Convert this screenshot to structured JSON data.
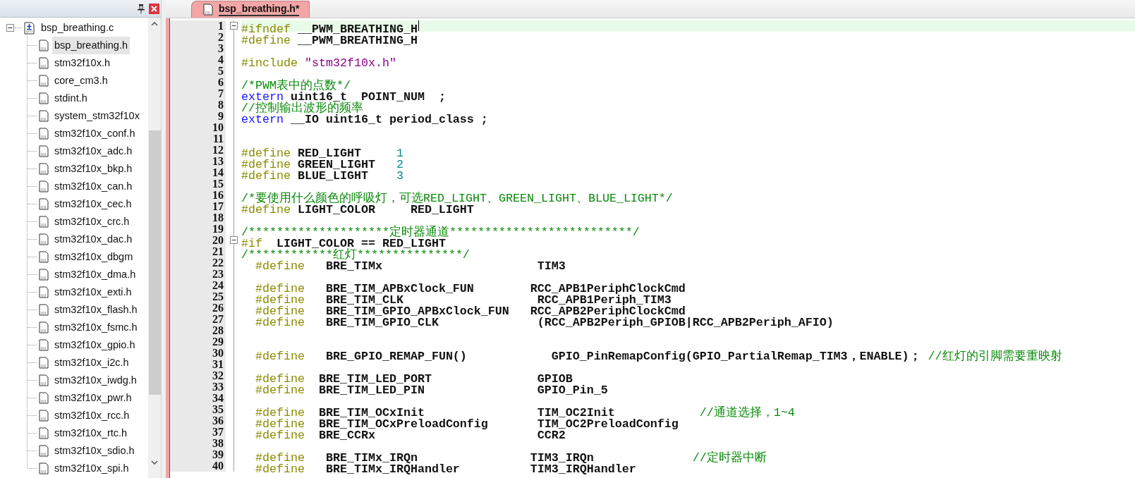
{
  "project_panel": {
    "tree": {
      "label": "bsp_breathing.c",
      "expanded": true,
      "children": [
        {
          "label": "bsp_breathing.h",
          "selected": true
        },
        {
          "label": "stm32f10x.h",
          "selected": false
        },
        {
          "label": "core_cm3.h",
          "selected": false
        },
        {
          "label": "stdint.h",
          "selected": false
        },
        {
          "label": "system_stm32f10x",
          "selected": false
        },
        {
          "label": "stm32f10x_conf.h",
          "selected": false
        },
        {
          "label": "stm32f10x_adc.h",
          "selected": false
        },
        {
          "label": "stm32f10x_bkp.h",
          "selected": false
        },
        {
          "label": "stm32f10x_can.h",
          "selected": false
        },
        {
          "label": "stm32f10x_cec.h",
          "selected": false
        },
        {
          "label": "stm32f10x_crc.h",
          "selected": false
        },
        {
          "label": "stm32f10x_dac.h",
          "selected": false
        },
        {
          "label": "stm32f10x_dbgm",
          "selected": false
        },
        {
          "label": "stm32f10x_dma.h",
          "selected": false
        },
        {
          "label": "stm32f10x_exti.h",
          "selected": false
        },
        {
          "label": "stm32f10x_flash.h",
          "selected": false
        },
        {
          "label": "stm32f10x_fsmc.h",
          "selected": false
        },
        {
          "label": "stm32f10x_gpio.h",
          "selected": false
        },
        {
          "label": "stm32f10x_i2c.h",
          "selected": false
        },
        {
          "label": "stm32f10x_iwdg.h",
          "selected": false
        },
        {
          "label": "stm32f10x_pwr.h",
          "selected": false
        },
        {
          "label": "stm32f10x_rcc.h",
          "selected": false
        },
        {
          "label": "stm32f10x_rtc.h",
          "selected": false
        },
        {
          "label": "stm32f10x_sdio.h",
          "selected": false
        },
        {
          "label": "stm32f10x_spi.h",
          "selected": false
        }
      ]
    }
  },
  "tabs": [
    {
      "label": "bsp_breathing.h*",
      "selected": true
    }
  ],
  "editor": {
    "lines": [
      {
        "number": "1",
        "fold": true,
        "current": true,
        "segments": [
          {
            "kind": "preproc",
            "text": "#ifndef"
          },
          {
            "kind": "plain",
            "text": " __PWM_BREATHING_H"
          }
        ]
      },
      {
        "number": "2",
        "fold": false,
        "current": false,
        "segments": [
          {
            "kind": "preproc",
            "text": "#define"
          },
          {
            "kind": "plain",
            "text": " __PWM_BREATHING_H"
          }
        ]
      },
      {
        "number": "3",
        "fold": false,
        "current": false
      },
      {
        "number": "4",
        "fold": false,
        "current": false,
        "segments": [
          {
            "kind": "preproc",
            "text": "#include"
          },
          {
            "kind": "string",
            "text": " \"stm32f10x.h\""
          }
        ]
      },
      {
        "number": "5",
        "fold": false,
        "current": false
      },
      {
        "number": "6",
        "fold": false,
        "current": false,
        "segments": [
          {
            "kind": "comment",
            "text": "/*PWM表中的点数*/"
          }
        ]
      },
      {
        "number": "7",
        "fold": false,
        "current": false,
        "segments": [
          {
            "kind": "keyword",
            "text": "extern"
          },
          {
            "kind": "plain",
            "text": " uint16_t  POINT_NUM  ;"
          }
        ]
      },
      {
        "number": "8",
        "fold": false,
        "current": false,
        "segments": [
          {
            "kind": "comment",
            "text": "//控制输出波形的频率"
          }
        ]
      },
      {
        "number": "9",
        "fold": false,
        "current": false,
        "segments": [
          {
            "kind": "keyword",
            "text": "extern"
          },
          {
            "kind": "plain",
            "text": " __IO uint16_t period_class ;"
          }
        ]
      },
      {
        "number": "10",
        "fold": false,
        "current": false
      },
      {
        "number": "11",
        "fold": false,
        "current": false
      },
      {
        "number": "12",
        "fold": false,
        "current": false,
        "segments": [
          {
            "kind": "preproc",
            "text": "#define"
          },
          {
            "kind": "plain",
            "text": " RED_LIGHT     "
          },
          {
            "kind": "number",
            "text": "1"
          }
        ]
      },
      {
        "number": "13",
        "fold": false,
        "current": false,
        "segments": [
          {
            "kind": "preproc",
            "text": "#define"
          },
          {
            "kind": "plain",
            "text": " GREEN_LIGHT   "
          },
          {
            "kind": "number",
            "text": "2"
          }
        ]
      },
      {
        "number": "14",
        "fold": false,
        "current": false,
        "segments": [
          {
            "kind": "preproc",
            "text": "#define"
          },
          {
            "kind": "plain",
            "text": " BLUE_LIGHT    "
          },
          {
            "kind": "number",
            "text": "3"
          }
        ]
      },
      {
        "number": "15",
        "fold": false,
        "current": false
      },
      {
        "number": "16",
        "fold": false,
        "current": false,
        "segments": [
          {
            "kind": "comment",
            "text": "/*要使用什么颜色的呼吸灯，可选RED_LIGHT、GREEN_LIGHT、BLUE_LIGHT*/"
          }
        ]
      },
      {
        "number": "17",
        "fold": false,
        "current": false,
        "segments": [
          {
            "kind": "preproc",
            "text": "#define"
          },
          {
            "kind": "plain",
            "text": " LIGHT_COLOR     RED_LIGHT"
          }
        ]
      },
      {
        "number": "18",
        "fold": false,
        "current": false
      },
      {
        "number": "19",
        "fold": false,
        "current": false,
        "segments": [
          {
            "kind": "comment",
            "text": "/********************定时器通道**************************/"
          }
        ]
      },
      {
        "number": "20",
        "fold": true,
        "current": false,
        "segments": [
          {
            "kind": "preproc",
            "text": "#if"
          },
          {
            "kind": "plain",
            "text": "  LIGHT_COLOR == RED_LIGHT"
          }
        ]
      },
      {
        "number": "21",
        "fold": false,
        "current": false,
        "segments": [
          {
            "kind": "comment",
            "text": "/************红灯***************/"
          }
        ]
      },
      {
        "number": "22",
        "fold": false,
        "current": false,
        "segments": [
          {
            "kind": "preproc",
            "text": "  #define"
          },
          {
            "kind": "plain",
            "text": "   BRE_TIMx                      TIM3"
          }
        ]
      },
      {
        "number": "23",
        "fold": false,
        "current": false
      },
      {
        "number": "24",
        "fold": false,
        "current": false,
        "segments": [
          {
            "kind": "preproc",
            "text": "  #define"
          },
          {
            "kind": "plain",
            "text": "   BRE_TIM_APBxClock_FUN        RCC_APB1PeriphClockCmd"
          }
        ]
      },
      {
        "number": "25",
        "fold": false,
        "current": false,
        "segments": [
          {
            "kind": "preproc",
            "text": "  #define"
          },
          {
            "kind": "plain",
            "text": "   BRE_TIM_CLK                   RCC_APB1Periph_TIM3"
          }
        ]
      },
      {
        "number": "26",
        "fold": false,
        "current": false,
        "segments": [
          {
            "kind": "preproc",
            "text": "  #define"
          },
          {
            "kind": "plain",
            "text": "   BRE_TIM_GPIO_APBxClock_FUN   RCC_APB2PeriphClockCmd"
          }
        ]
      },
      {
        "number": "27",
        "fold": false,
        "current": false,
        "segments": [
          {
            "kind": "preproc",
            "text": "  #define"
          },
          {
            "kind": "plain",
            "text": "   BRE_TIM_GPIO_CLK              (RCC_APB2Periph_GPIOB|RCC_APB2Periph_AFIO)"
          }
        ]
      },
      {
        "number": "28",
        "fold": false,
        "current": false
      },
      {
        "number": "29",
        "fold": false,
        "current": false
      },
      {
        "number": "30",
        "fold": false,
        "current": false,
        "segments": [
          {
            "kind": "preproc",
            "text": "  #define"
          },
          {
            "kind": "plain",
            "text": "   BRE_GPIO_REMAP_FUN()            GPIO_PinRemapConfig(GPIO_PartialRemap_TIM3，ENABLE)； "
          },
          {
            "kind": "comment",
            "text": "//红灯的引脚需要重映射"
          }
        ]
      },
      {
        "number": "31",
        "fold": false,
        "current": false
      },
      {
        "number": "32",
        "fold": false,
        "current": false,
        "segments": [
          {
            "kind": "preproc",
            "text": "  #define"
          },
          {
            "kind": "plain",
            "text": "  BRE_TIM_LED_PORT               GPIOB"
          }
        ]
      },
      {
        "number": "33",
        "fold": false,
        "current": false,
        "segments": [
          {
            "kind": "preproc",
            "text": "  #define"
          },
          {
            "kind": "plain",
            "text": "  BRE_TIM_LED_PIN                GPIO_Pin_5"
          }
        ]
      },
      {
        "number": "34",
        "fold": false,
        "current": false
      },
      {
        "number": "35",
        "fold": false,
        "current": false,
        "segments": [
          {
            "kind": "preproc",
            "text": "  #define"
          },
          {
            "kind": "plain",
            "text": "  BRE_TIM_OCxInit                TIM_OC2Init            "
          },
          {
            "kind": "comment",
            "text": "//通道选择，1~4"
          }
        ]
      },
      {
        "number": "36",
        "fold": false,
        "current": false,
        "segments": [
          {
            "kind": "preproc",
            "text": "  #define"
          },
          {
            "kind": "plain",
            "text": "  BRE_TIM_OCxPreloadConfig       TIM_OC2PreloadConfig"
          }
        ]
      },
      {
        "number": "37",
        "fold": false,
        "current": false,
        "segments": [
          {
            "kind": "preproc",
            "text": "  #define"
          },
          {
            "kind": "plain",
            "text": "  BRE_CCRx                       CCR2"
          }
        ]
      },
      {
        "number": "38",
        "fold": false,
        "current": false
      },
      {
        "number": "39",
        "fold": false,
        "current": false,
        "segments": [
          {
            "kind": "preproc",
            "text": "  #define"
          },
          {
            "kind": "plain",
            "text": "   BRE_TIMx_IRQn                TIM3_IRQn              "
          },
          {
            "kind": "comment",
            "text": "//定时器中断"
          }
        ]
      },
      {
        "number": "40",
        "fold": false,
        "current": false,
        "segments": [
          {
            "kind": "preproc",
            "text": "  #define"
          },
          {
            "kind": "plain",
            "text": "   BRE_TIMx_IRQHandler          TIM3_IRQHandler"
          }
        ]
      }
    ]
  }
}
